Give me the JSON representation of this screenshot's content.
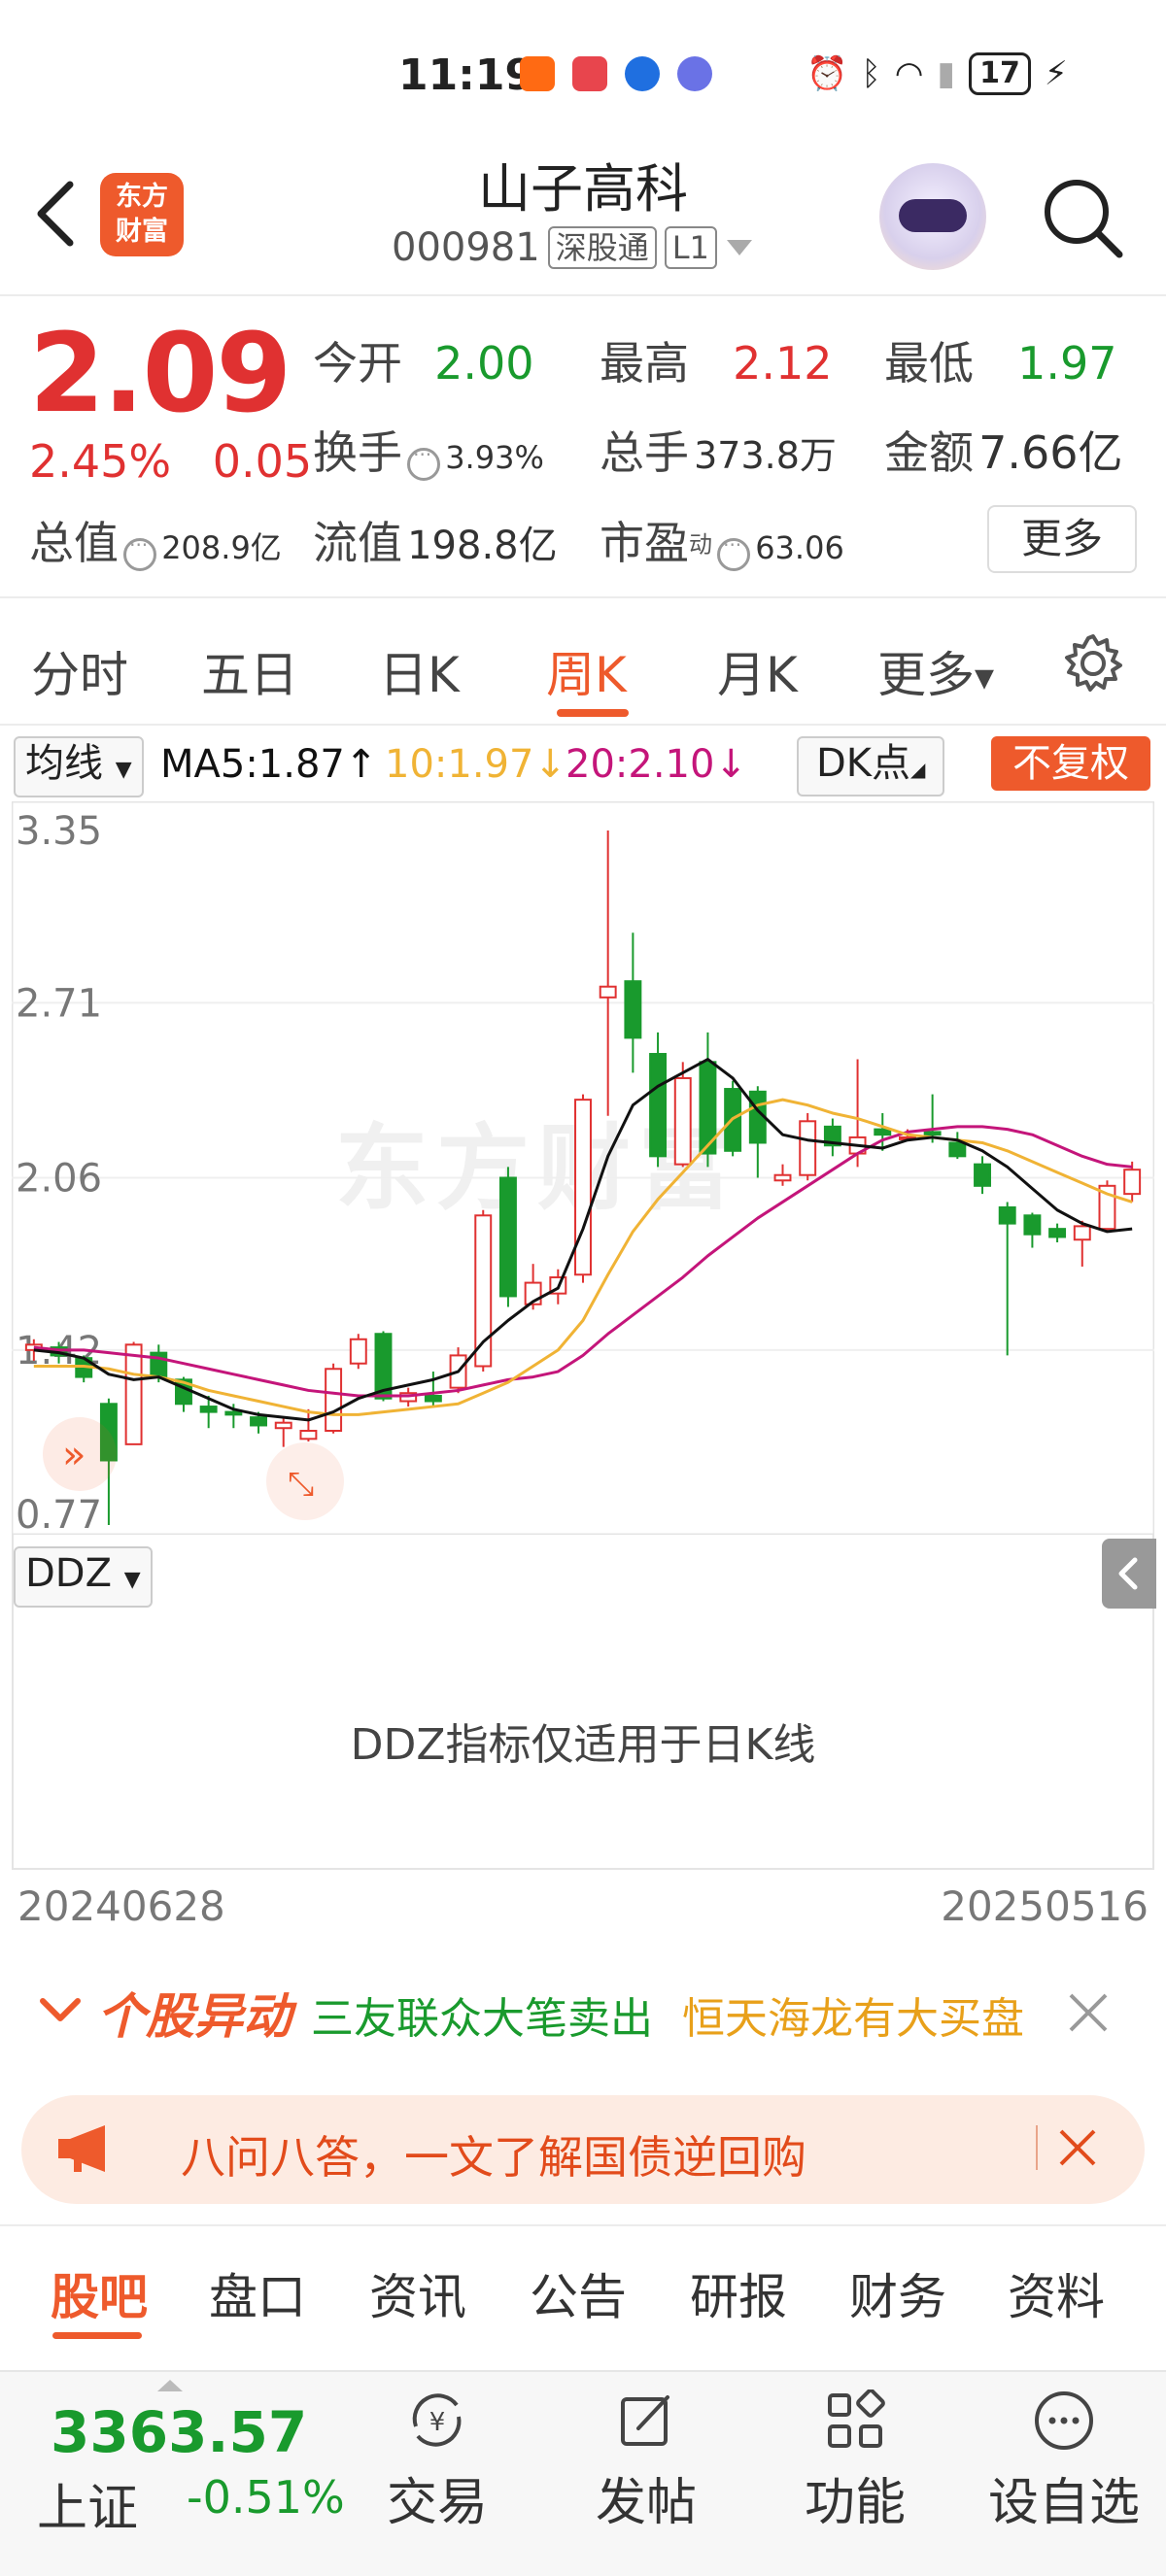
{
  "status_bar": {
    "time": "11:19",
    "battery": "17"
  },
  "header": {
    "logo_line1": "东方",
    "logo_line2": "财富",
    "stock_name": "山子高科",
    "stock_code": "000981",
    "tag_connect": "深股通",
    "tag_level": "L1"
  },
  "quote": {
    "price": "2.09",
    "change_pct": "2.45%",
    "change_amt": "0.05",
    "open_label": "今开",
    "open": "2.00",
    "high_label": "最高",
    "high": "2.12",
    "low_label": "最低",
    "low": "1.97",
    "turnover_label": "换手",
    "turnover": "3.93%",
    "volume_label": "总手",
    "volume": "373.8万",
    "amount_label": "金额",
    "amount": "7.66亿",
    "mktcap_label": "总值",
    "mktcap": "208.9亿",
    "float_label": "流值",
    "float": "198.8亿",
    "pe_label": "市盈",
    "pe_sup": "动",
    "pe": "63.06",
    "more": "更多"
  },
  "period_tabs": [
    "分时",
    "五日",
    "日K",
    "周K",
    "月K",
    "更多"
  ],
  "active_period": "周K",
  "ma_row": {
    "selector": "均线",
    "ma5": "MA5:1.87",
    "ma10": "10:1.97",
    "ma20": "20:2.10",
    "dk": "DK点",
    "fq": "不复权"
  },
  "colors": {
    "up": "#e03131",
    "down": "#199a2d",
    "brand": "#ee5a2c",
    "ma5": "#111111",
    "ma10": "#f0b335",
    "ma20": "#c4157a"
  },
  "chart_data": {
    "type": "candlestick",
    "y_ticks": [
      "3.35",
      "2.71",
      "2.06",
      "1.42",
      "0.77"
    ],
    "ylim": [
      0.77,
      3.35
    ],
    "x_start_label": "20240628",
    "x_end_label": "20250516",
    "candles": [
      {
        "o": 1.42,
        "h": 1.46,
        "l": 1.38,
        "c": 1.44
      },
      {
        "o": 1.43,
        "h": 1.45,
        "l": 1.37,
        "c": 1.4
      },
      {
        "o": 1.39,
        "h": 1.4,
        "l": 1.3,
        "c": 1.32
      },
      {
        "o": 1.22,
        "h": 1.24,
        "l": 0.77,
        "c": 1.01
      },
      {
        "o": 1.07,
        "h": 1.45,
        "l": 1.07,
        "c": 1.44
      },
      {
        "o": 1.41,
        "h": 1.44,
        "l": 1.3,
        "c": 1.32
      },
      {
        "o": 1.31,
        "h": 1.32,
        "l": 1.19,
        "c": 1.22
      },
      {
        "o": 1.21,
        "h": 1.25,
        "l": 1.13,
        "c": 1.19
      },
      {
        "o": 1.19,
        "h": 1.22,
        "l": 1.13,
        "c": 1.18
      },
      {
        "o": 1.17,
        "h": 1.19,
        "l": 1.11,
        "c": 1.14
      },
      {
        "o": 1.13,
        "h": 1.17,
        "l": 1.06,
        "c": 1.15
      },
      {
        "o": 1.09,
        "h": 1.2,
        "l": 1.08,
        "c": 1.12
      },
      {
        "o": 1.12,
        "h": 1.37,
        "l": 1.11,
        "c": 1.35
      },
      {
        "o": 1.37,
        "h": 1.48,
        "l": 1.35,
        "c": 1.46
      },
      {
        "o": 1.48,
        "h": 1.49,
        "l": 1.23,
        "c": 1.24
      },
      {
        "o": 1.23,
        "h": 1.28,
        "l": 1.21,
        "c": 1.26
      },
      {
        "o": 1.25,
        "h": 1.34,
        "l": 1.21,
        "c": 1.23
      },
      {
        "o": 1.28,
        "h": 1.43,
        "l": 1.26,
        "c": 1.4
      },
      {
        "o": 1.36,
        "h": 1.94,
        "l": 1.34,
        "c": 1.92
      },
      {
        "o": 2.06,
        "h": 2.1,
        "l": 1.58,
        "c": 1.62
      },
      {
        "o": 1.59,
        "h": 1.74,
        "l": 1.57,
        "c": 1.67
      },
      {
        "o": 1.63,
        "h": 1.72,
        "l": 1.59,
        "c": 1.69
      },
      {
        "o": 1.7,
        "h": 2.37,
        "l": 1.67,
        "c": 2.35
      },
      {
        "o": 2.73,
        "h": 3.35,
        "l": 2.29,
        "c": 2.77
      },
      {
        "o": 2.79,
        "h": 2.97,
        "l": 2.45,
        "c": 2.58
      },
      {
        "o": 2.52,
        "h": 2.6,
        "l": 2.1,
        "c": 2.14
      },
      {
        "o": 2.11,
        "h": 2.49,
        "l": 2.1,
        "c": 2.43
      },
      {
        "o": 2.49,
        "h": 2.6,
        "l": 2.1,
        "c": 2.15
      },
      {
        "o": 2.39,
        "h": 2.42,
        "l": 2.14,
        "c": 2.16
      },
      {
        "o": 2.38,
        "h": 2.4,
        "l": 2.06,
        "c": 2.19
      },
      {
        "o": 2.05,
        "h": 2.11,
        "l": 2.03,
        "c": 2.07
      },
      {
        "o": 2.07,
        "h": 2.3,
        "l": 2.05,
        "c": 2.27
      },
      {
        "o": 2.25,
        "h": 2.28,
        "l": 2.14,
        "c": 2.18
      },
      {
        "o": 2.15,
        "h": 2.5,
        "l": 2.1,
        "c": 2.21
      },
      {
        "o": 2.24,
        "h": 2.3,
        "l": 2.16,
        "c": 2.22
      },
      {
        "o": 2.21,
        "h": 2.24,
        "l": 2.2,
        "c": 2.21
      },
      {
        "o": 2.23,
        "h": 2.37,
        "l": 2.19,
        "c": 2.22
      },
      {
        "o": 2.19,
        "h": 2.23,
        "l": 2.13,
        "c": 2.14
      },
      {
        "o": 2.11,
        "h": 2.14,
        "l": 2.0,
        "c": 2.03
      },
      {
        "o": 1.95,
        "h": 1.97,
        "l": 1.4,
        "c": 1.89
      },
      {
        "o": 1.92,
        "h": 1.93,
        "l": 1.8,
        "c": 1.85
      },
      {
        "o": 1.87,
        "h": 1.89,
        "l": 1.82,
        "c": 1.84
      },
      {
        "o": 1.83,
        "h": 1.9,
        "l": 1.73,
        "c": 1.88
      },
      {
        "o": 1.87,
        "h": 2.05,
        "l": 1.86,
        "c": 2.03
      },
      {
        "o": 2.0,
        "h": 2.12,
        "l": 1.97,
        "c": 2.09
      }
    ],
    "ma5": [
      1.42,
      1.41,
      1.39,
      1.33,
      1.31,
      1.32,
      1.28,
      1.24,
      1.2,
      1.18,
      1.17,
      1.16,
      1.19,
      1.24,
      1.27,
      1.29,
      1.31,
      1.34,
      1.45,
      1.53,
      1.6,
      1.65,
      1.87,
      2.14,
      2.33,
      2.4,
      2.45,
      2.5,
      2.43,
      2.31,
      2.22,
      2.2,
      2.19,
      2.18,
      2.17,
      2.2,
      2.21,
      2.2,
      2.16,
      2.1,
      2.02,
      1.94,
      1.89,
      1.86,
      1.87
    ],
    "ma10": [
      1.36,
      1.36,
      1.36,
      1.35,
      1.33,
      1.32,
      1.3,
      1.27,
      1.25,
      1.23,
      1.21,
      1.19,
      1.18,
      1.18,
      1.19,
      1.2,
      1.21,
      1.22,
      1.26,
      1.3,
      1.36,
      1.42,
      1.53,
      1.7,
      1.86,
      1.98,
      2.08,
      2.18,
      2.28,
      2.33,
      2.35,
      2.33,
      2.3,
      2.28,
      2.25,
      2.22,
      2.21,
      2.2,
      2.19,
      2.16,
      2.12,
      2.08,
      2.04,
      2.0,
      1.97
    ],
    "ma20": [
      1.43,
      1.42,
      1.42,
      1.41,
      1.4,
      1.39,
      1.37,
      1.35,
      1.33,
      1.31,
      1.29,
      1.27,
      1.26,
      1.25,
      1.25,
      1.25,
      1.26,
      1.27,
      1.29,
      1.31,
      1.32,
      1.34,
      1.4,
      1.48,
      1.55,
      1.62,
      1.69,
      1.77,
      1.84,
      1.91,
      1.97,
      2.03,
      2.09,
      2.15,
      2.2,
      2.23,
      2.24,
      2.25,
      2.25,
      2.24,
      2.22,
      2.18,
      2.14,
      2.11,
      2.1
    ]
  },
  "ddz": {
    "selector": "DDZ",
    "message": "DDZ指标仅适用于日K线"
  },
  "anomaly": {
    "title": "个股异动",
    "item1": "三友联众大笔卖出",
    "item2": "恒天海龙有大买盘"
  },
  "notice": {
    "text": "八问八答，一文了解国债逆回购"
  },
  "bottom_tabs": [
    "股吧",
    "盘口",
    "资讯",
    "公告",
    "研报",
    "财务",
    "资料"
  ],
  "bottom_bar": {
    "index_value": "3363.57",
    "index_name": "上证",
    "index_change": "-0.51%",
    "items": [
      "交易",
      "发帖",
      "功能",
      "设自选"
    ]
  }
}
